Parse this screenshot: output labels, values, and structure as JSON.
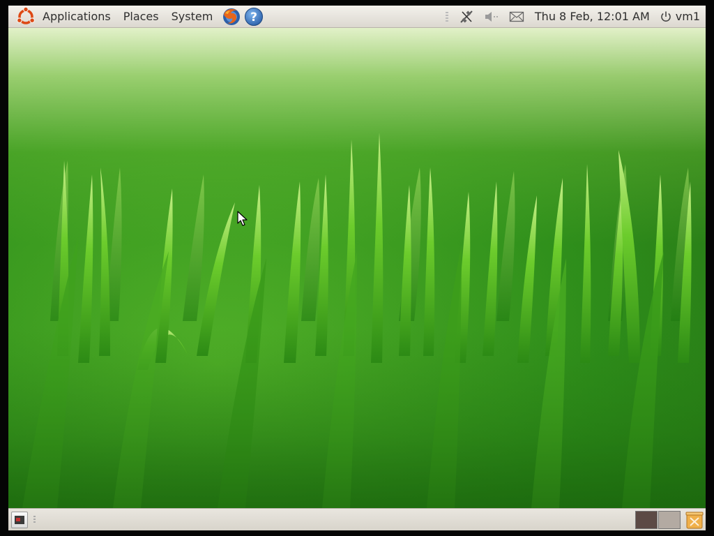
{
  "top_panel": {
    "menus": {
      "applications": "Applications",
      "places": "Places",
      "system": "System"
    },
    "launchers": [
      "firefox-icon",
      "help-icon"
    ],
    "tray_icons": [
      "network-disconnected-icon",
      "volume-muted-icon",
      "mail-icon"
    ],
    "clock": "Thu  8 Feb, 12:01 AM",
    "user": "vm1"
  },
  "bottom_panel": {
    "show_desktop": "show-desktop-icon",
    "workspaces": [
      {
        "active": true,
        "color": "#5c4a45"
      },
      {
        "active": false,
        "color": "#b3aaa2"
      }
    ],
    "trash": "trash-icon"
  },
  "colors": {
    "panel_bg": "#e4e1da",
    "panel_text": "#2e2e2e",
    "wallpaper_green": "#2f8f1b",
    "ubuntu_orange": "#dd4814"
  }
}
